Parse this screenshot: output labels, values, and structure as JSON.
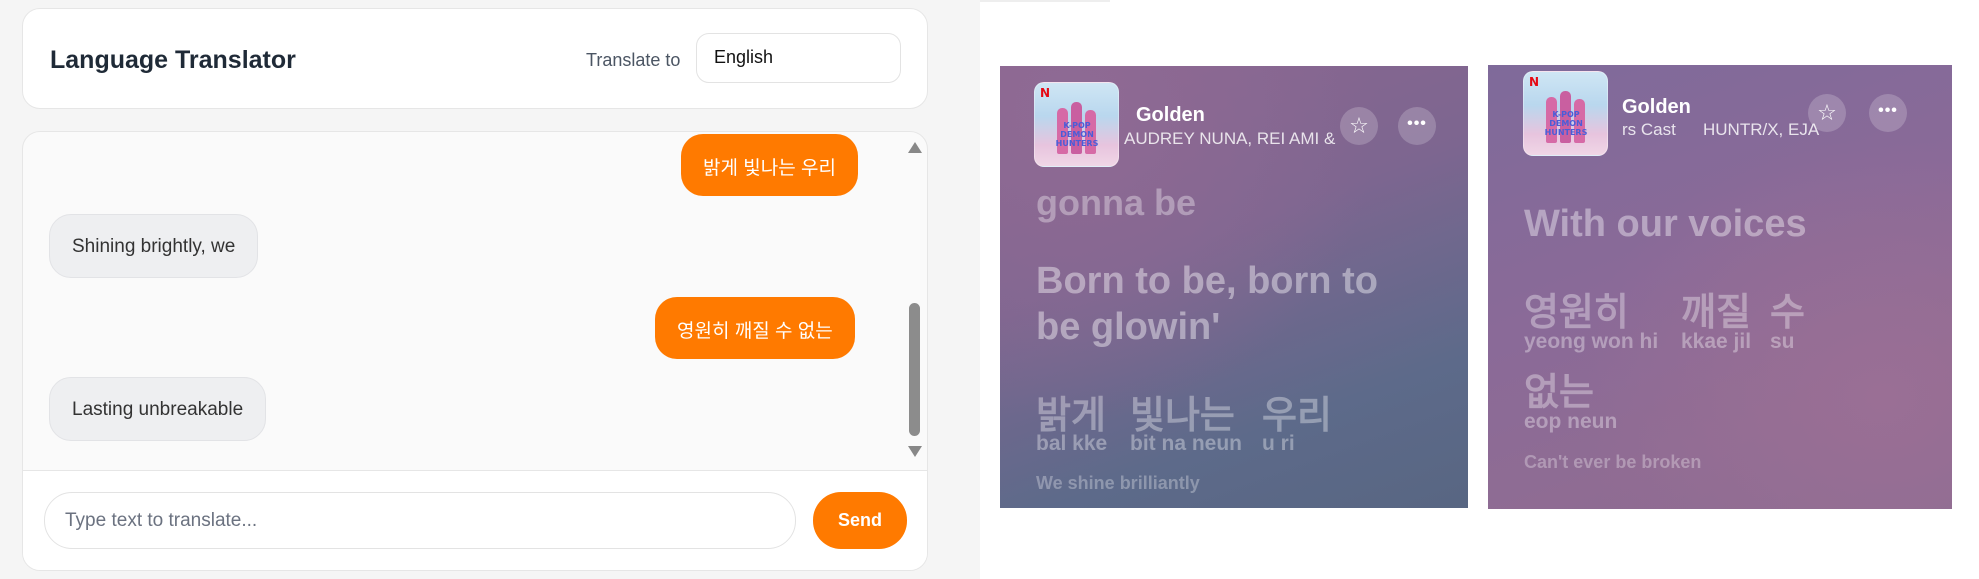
{
  "translator": {
    "title": "Language Translator",
    "translate_to_label": "Translate to",
    "selected_language": "English",
    "messages": [
      {
        "role": "user",
        "text": "밝게 빛나는 우리"
      },
      {
        "role": "bot",
        "text": "Shining brightly, we"
      },
      {
        "role": "user",
        "text": "영원히 깨질 수 없는"
      },
      {
        "role": "bot",
        "text": "Lasting unbreakable"
      }
    ],
    "input_placeholder": "Type text to translate...",
    "send_label": "Send",
    "accent_color": "#ff7a00"
  },
  "lyrics_a": {
    "song_title": "Golden",
    "artists": "AUDREY NUNA, REI AMI &",
    "star_icon": "star-outline-icon",
    "more_icon": "more-dots-icon",
    "line_prev": "gonna be",
    "line_current": [
      "Born to be, born to",
      "be glowin'"
    ],
    "korean_words": [
      {
        "hangul": "밝게",
        "roman": "bal kke"
      },
      {
        "hangul": "빛나는",
        "roman": "bit na neun"
      },
      {
        "hangul": "우리",
        "roman": "u ri"
      }
    ],
    "translation": "We shine brilliantly"
  },
  "lyrics_b": {
    "song_title": "Golden",
    "artists_left": "rs Cast",
    "artists_right": "HUNTR/X, EJA",
    "line_prev": "With our voices",
    "korean_words": [
      {
        "hangul": "영원히",
        "roman": "yeong won hi"
      },
      {
        "hangul": "깨질",
        "roman": "kkae jil"
      },
      {
        "hangul": "수",
        "roman": "su"
      },
      {
        "hangul": "없는",
        "roman": "eop neun"
      }
    ],
    "translation": "Can't ever be broken"
  }
}
